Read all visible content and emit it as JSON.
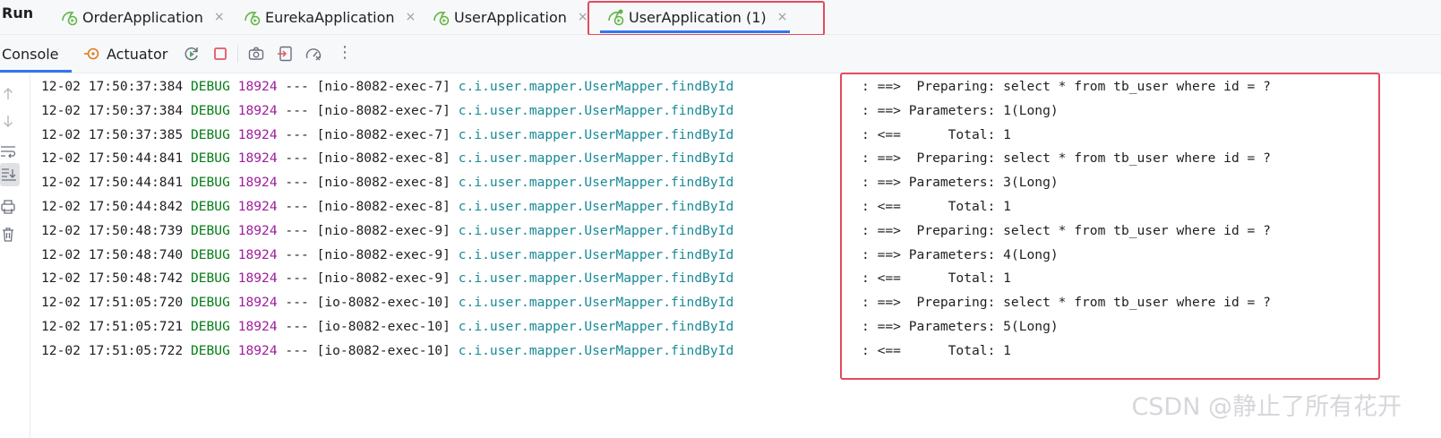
{
  "run_bar": {
    "title": "Run",
    "tabs": [
      {
        "label": "OrderApplication",
        "icon": "spring-boot-run-icon",
        "close": "×"
      },
      {
        "label": "EurekaApplication",
        "icon": "spring-boot-run-icon",
        "close": "×"
      },
      {
        "label": "UserApplication",
        "icon": "spring-boot-run-icon",
        "close": "×"
      },
      {
        "label": "UserApplication (1)",
        "icon": "spring-boot-run-icon",
        "close": "×",
        "active": true
      }
    ]
  },
  "console_bar": {
    "console_label": "Console",
    "actuator_label": "Actuator",
    "tools": [
      "rerun-icon",
      "stop-icon",
      "screenshot-icon",
      "restore-layout-icon",
      "profiler-icon",
      "more-icon"
    ],
    "more_label": "⋮"
  },
  "gutter": {
    "icons": [
      "arrow-up-icon",
      "arrow-down-icon",
      "soft-wrap-icon",
      "scroll-to-end-icon",
      "print-icon",
      "clear-icon"
    ]
  },
  "log": {
    "lines": [
      {
        "ts": "12-02 17:50:37:384",
        "level": "DEBUG",
        "pid": "18924",
        "sep": "---",
        "thread": "[nio-8082-exec-7]",
        "logger": "c.i.user.mapper.UserMapper.findById",
        "msg": ": ==>  Preparing: select * from tb_user where id = ?"
      },
      {
        "ts": "12-02 17:50:37:384",
        "level": "DEBUG",
        "pid": "18924",
        "sep": "---",
        "thread": "[nio-8082-exec-7]",
        "logger": "c.i.user.mapper.UserMapper.findById",
        "msg": ": ==> Parameters: 1(Long)"
      },
      {
        "ts": "12-02 17:50:37:385",
        "level": "DEBUG",
        "pid": "18924",
        "sep": "---",
        "thread": "[nio-8082-exec-7]",
        "logger": "c.i.user.mapper.UserMapper.findById",
        "msg": ": <==      Total: 1"
      },
      {
        "ts": "12-02 17:50:44:841",
        "level": "DEBUG",
        "pid": "18924",
        "sep": "---",
        "thread": "[nio-8082-exec-8]",
        "logger": "c.i.user.mapper.UserMapper.findById",
        "msg": ": ==>  Preparing: select * from tb_user where id = ?"
      },
      {
        "ts": "12-02 17:50:44:841",
        "level": "DEBUG",
        "pid": "18924",
        "sep": "---",
        "thread": "[nio-8082-exec-8]",
        "logger": "c.i.user.mapper.UserMapper.findById",
        "msg": ": ==> Parameters: 3(Long)"
      },
      {
        "ts": "12-02 17:50:44:842",
        "level": "DEBUG",
        "pid": "18924",
        "sep": "---",
        "thread": "[nio-8082-exec-8]",
        "logger": "c.i.user.mapper.UserMapper.findById",
        "msg": ": <==      Total: 1"
      },
      {
        "ts": "12-02 17:50:48:739",
        "level": "DEBUG",
        "pid": "18924",
        "sep": "---",
        "thread": "[nio-8082-exec-9]",
        "logger": "c.i.user.mapper.UserMapper.findById",
        "msg": ": ==>  Preparing: select * from tb_user where id = ?"
      },
      {
        "ts": "12-02 17:50:48:740",
        "level": "DEBUG",
        "pid": "18924",
        "sep": "---",
        "thread": "[nio-8082-exec-9]",
        "logger": "c.i.user.mapper.UserMapper.findById",
        "msg": ": ==> Parameters: 4(Long)"
      },
      {
        "ts": "12-02 17:50:48:742",
        "level": "DEBUG",
        "pid": "18924",
        "sep": "---",
        "thread": "[nio-8082-exec-9]",
        "logger": "c.i.user.mapper.UserMapper.findById",
        "msg": ": <==      Total: 1"
      },
      {
        "ts": "12-02 17:51:05:720",
        "level": "DEBUG",
        "pid": "18924",
        "sep": "---",
        "thread": "[io-8082-exec-10]",
        "logger": "c.i.user.mapper.UserMapper.findById",
        "msg": ": ==>  Preparing: select * from tb_user where id = ?"
      },
      {
        "ts": "12-02 17:51:05:721",
        "level": "DEBUG",
        "pid": "18924",
        "sep": "---",
        "thread": "[io-8082-exec-10]",
        "logger": "c.i.user.mapper.UserMapper.findById",
        "msg": ": ==> Parameters: 5(Long)"
      },
      {
        "ts": "12-02 17:51:05:722",
        "level": "DEBUG",
        "pid": "18924",
        "sep": "---",
        "thread": "[io-8082-exec-10]",
        "logger": "c.i.user.mapper.UserMapper.findById",
        "msg": ": <==      Total: 1"
      }
    ]
  },
  "watermark": "CSDN @静止了所有花开",
  "colors": {
    "level": "#067d17",
    "pid": "#9e1d9e",
    "logger": "#1a8a96",
    "accent": "#3574f0",
    "highlight": "#e24b5d"
  }
}
